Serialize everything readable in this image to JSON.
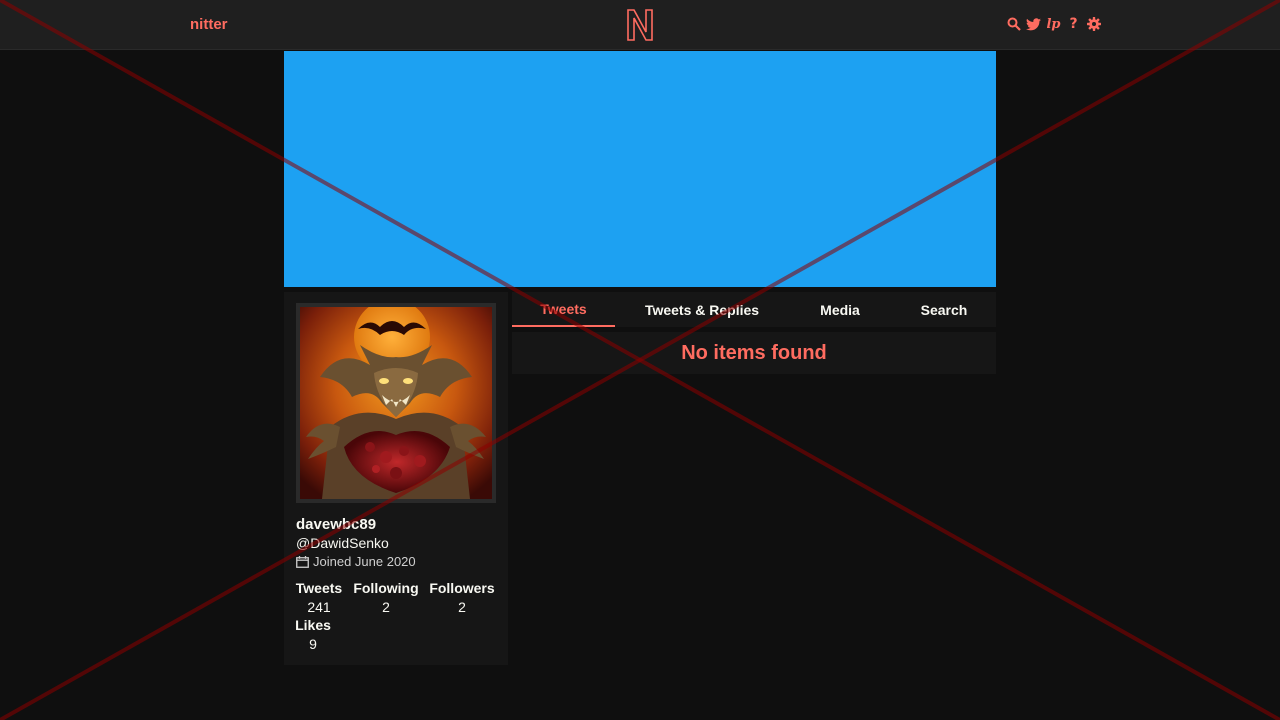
{
  "navbar": {
    "brand": "nitter",
    "icons": [
      "search-icon",
      "twitter-bird-icon",
      "rss-icon",
      "help-icon",
      "gear-icon"
    ],
    "rss_text": "lp",
    "help_text": "?"
  },
  "colors": {
    "accent": "#ff6c60",
    "banner": "#1da1f2",
    "background": "#0f0f0f",
    "card": "#161616",
    "navbar": "#1f1f1f"
  },
  "profile": {
    "fullname": "davewbc89",
    "username": "@DawidSenko",
    "joined": "Joined June 2020",
    "stats": {
      "tweets_label": "Tweets",
      "tweets": "241",
      "following_label": "Following",
      "following": "2",
      "followers_label": "Followers",
      "followers": "2",
      "likes_label": "Likes",
      "likes": "9"
    }
  },
  "tabs": [
    {
      "label": "Tweets",
      "active": true
    },
    {
      "label": "Tweets & Replies",
      "active": false
    },
    {
      "label": "Media",
      "active": false
    },
    {
      "label": "Search",
      "active": false
    }
  ],
  "timeline": {
    "empty_message": "No items found"
  }
}
